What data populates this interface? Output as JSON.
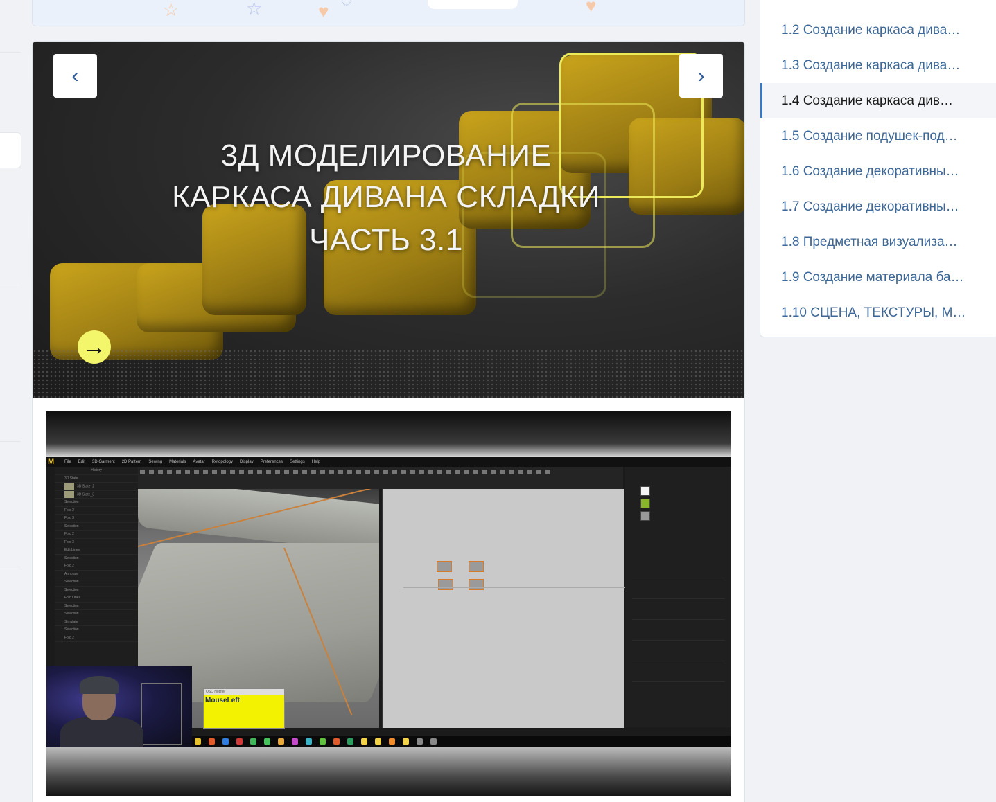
{
  "slider": {
    "title_line1": "3Д МОДЕЛИРОВАНИЕ",
    "title_line2": "КАРКАСА ДИВАНА  СКЛАДКИ",
    "title_line3": "ЧАСТЬ 3.1",
    "prev_icon": "chevron-left-icon",
    "next_icon": "chevron-right-icon",
    "go_icon": "arrow-right-circle-icon",
    "accent_color": "#f3f56a"
  },
  "video": {
    "app_logo": "M",
    "menu": [
      "File",
      "Edit",
      "3D Garment",
      "2D Pattern",
      "Sewing",
      "Materials",
      "Avatar",
      "Retopology",
      "Display",
      "Preferences",
      "Settings",
      "Help"
    ],
    "history_title": "History",
    "history_items": [
      "3D State",
      "3D State_2",
      "3D State_3",
      "Selection",
      "Fold 2",
      "Fold 3",
      "Selection",
      "Fold 2",
      "Fold 3",
      "Edit Lines",
      "Selection",
      "Fold 2",
      "Annotate",
      "Selection",
      "Selection",
      "Fold Lines",
      "Selection",
      "Selection",
      "Simulate",
      "Selection",
      "Fold 2"
    ],
    "keypress_title": "OSD Notifier",
    "keypress_text": "MouseLeft"
  },
  "toc": {
    "items": [
      {
        "label": "1.2 Создание каркаса дива…",
        "active": false
      },
      {
        "label": "1.3 Создание каркаса дива…",
        "active": false
      },
      {
        "label": "1.4 Создание каркаса див…",
        "active": true
      },
      {
        "label": "1.5 Создание подушек-под…",
        "active": false
      },
      {
        "label": "1.6 Создание декоративны…",
        "active": false
      },
      {
        "label": "1.7 Создание декоративны…",
        "active": false
      },
      {
        "label": "1.8 Предметная визуализа…",
        "active": false
      },
      {
        "label": "1.9 Создание материала ба…",
        "active": false
      },
      {
        "label": "1.10 СЦЕНА, ТЕКСТУРЫ, М…",
        "active": false
      }
    ],
    "active_color": "#3a78c6",
    "link_color": "#3d6796"
  }
}
